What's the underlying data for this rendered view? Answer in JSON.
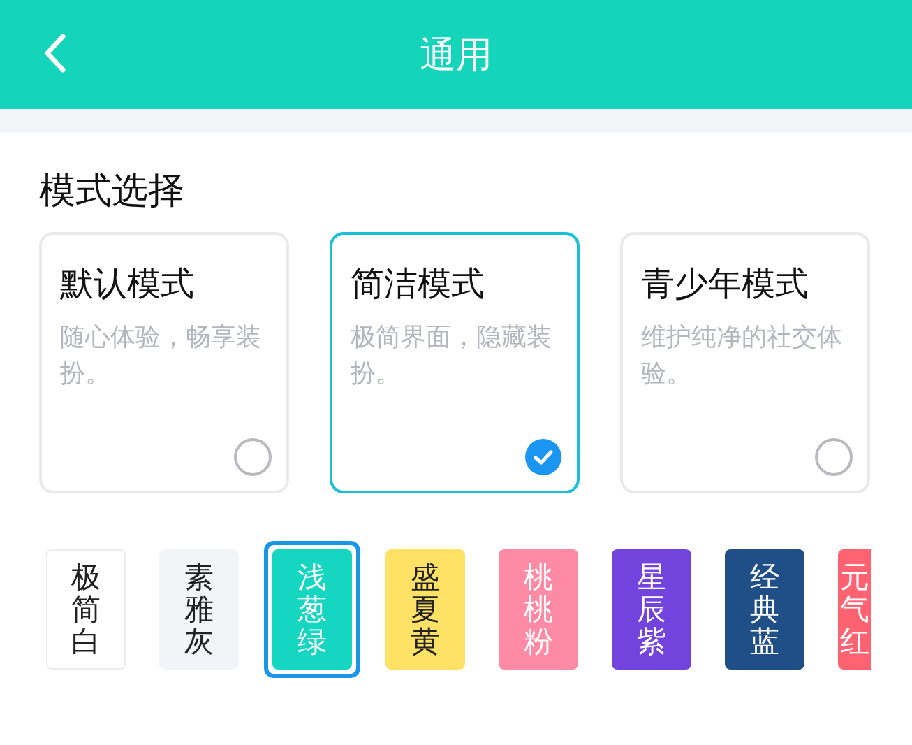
{
  "header": {
    "title": "通用"
  },
  "section": {
    "title": "模式选择"
  },
  "modes": [
    {
      "title": "默认模式",
      "description": "随心体验，畅享装扮。",
      "selected": false
    },
    {
      "title": "简洁模式",
      "description": "极简界面，隐藏装扮。",
      "selected": true
    },
    {
      "title": "青少年模式",
      "description": "维护纯净的社交体验。",
      "selected": false
    }
  ],
  "themes": [
    {
      "label": "极简白",
      "color": "#ffffff",
      "kind": "dark",
      "selected": false
    },
    {
      "label": "素雅灰",
      "color": "#f3f4f8",
      "kind": "dark",
      "selected": false
    },
    {
      "label": "浅葱绿",
      "color": "#15d6c1",
      "kind": "light",
      "selected": true
    },
    {
      "label": "盛夏黄",
      "color": "#ffe265",
      "kind": "dark",
      "selected": false
    },
    {
      "label": "桃桃粉",
      "color": "#ff8aa3",
      "kind": "light",
      "selected": false
    },
    {
      "label": "星辰紫",
      "color": "#7343dd",
      "kind": "light",
      "selected": false
    },
    {
      "label": "经典蓝",
      "color": "#1f4f86",
      "kind": "light",
      "selected": false
    },
    {
      "label": "元气红",
      "color": "#ff6372",
      "kind": "light",
      "selected": false
    }
  ]
}
